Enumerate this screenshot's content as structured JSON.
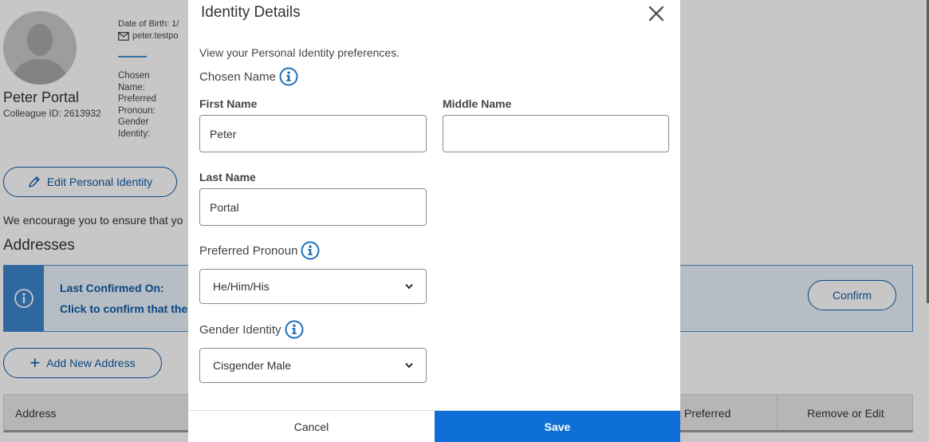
{
  "profile": {
    "name": "Peter Portal",
    "colleague_id": "Colleague ID: 2613932",
    "dob": "Date of Birth: 1/",
    "email": "peter.testpo",
    "labels": [
      "Chosen",
      "Name:",
      "Preferred",
      "Pronoun:",
      "Gender",
      "Identity:"
    ]
  },
  "actions": {
    "edit_identity": "Edit Personal Identity",
    "add_address": "Add New Address",
    "confirm": "Confirm"
  },
  "encourage_text": "We encourage you to ensure that yo",
  "addresses": {
    "heading": "Addresses",
    "alert_title": "Last Confirmed On:",
    "alert_body": "Click to confirm that the",
    "table_headers": {
      "address": "Address",
      "preferred": "Preferred",
      "remove_edit": "Remove or Edit"
    }
  },
  "modal": {
    "title": "Identity Details",
    "description": "View your Personal Identity preferences.",
    "chosen_name_label": "Chosen Name",
    "first_name_label": "First Name",
    "first_name_value": "Peter",
    "middle_name_label": "Middle Name",
    "middle_name_value": "",
    "last_name_label": "Last Name",
    "last_name_value": "Portal",
    "pronoun_label": "Preferred Pronoun",
    "pronoun_value": "He/Him/His",
    "gender_label": "Gender Identity",
    "gender_value": "Cisgender Male",
    "cancel": "Cancel",
    "save": "Save"
  },
  "colors": {
    "primary": "#0e5aa7",
    "save": "#0e6fd6",
    "alert_bg": "#eaf3fc",
    "alert_accent": "#3d84cc"
  }
}
